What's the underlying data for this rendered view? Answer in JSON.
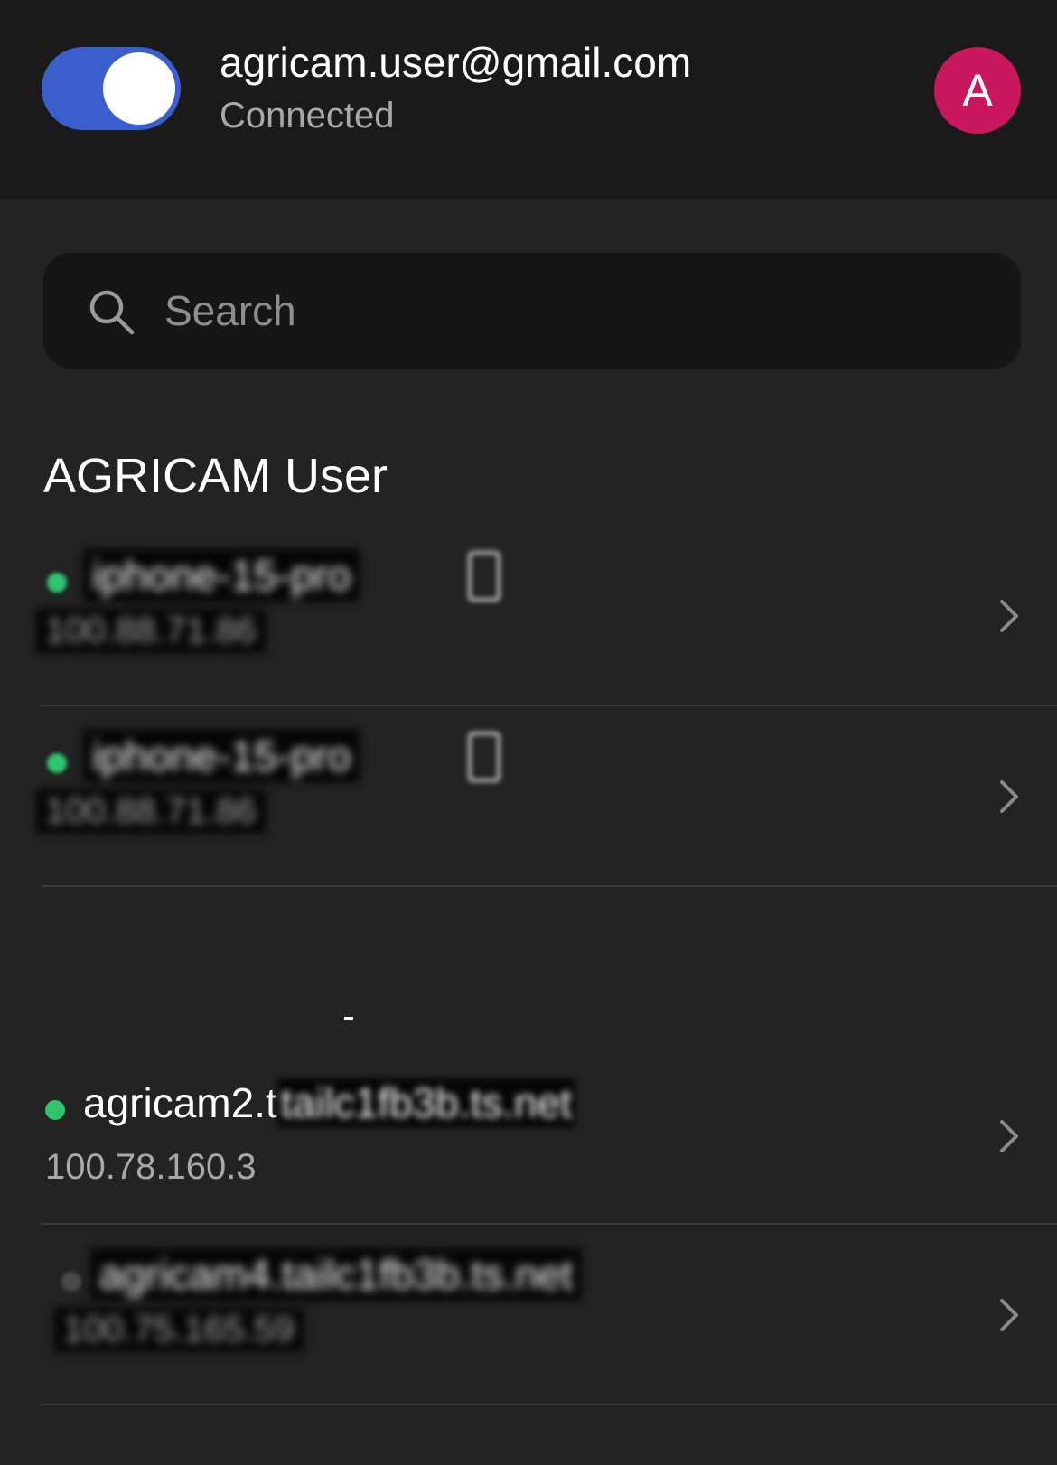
{
  "colors": {
    "background": "#232323",
    "header_background": "#1a1a1a",
    "toggle_on": "#3a5fcd",
    "avatar": "#c8175d",
    "online": "#30c46c",
    "offline": "#4a4a4a"
  },
  "header": {
    "vpn_toggle_on": true,
    "account_email": "agricam.user@gmail.com",
    "status": "Connected",
    "avatar_initial": "A"
  },
  "search": {
    "placeholder": "Search",
    "icon": "search-icon"
  },
  "sections": [
    {
      "title": "AGRICAM User",
      "devices": [
        {
          "name": "iphone-15-pro",
          "ip": "100.88.71.86",
          "online": true,
          "redacted": true,
          "icon": "phone-icon"
        },
        {
          "name": "iphone-15-pro",
          "ip": "100.88.71.86",
          "online": true,
          "redacted": true,
          "icon": "phone-icon"
        }
      ]
    },
    {
      "title": "",
      "devices": [
        {
          "name_visible": "agricam2.t",
          "name_hidden": "tailc1fb3b.ts.net",
          "ip": "100.78.160.3",
          "online": true
        },
        {
          "name": "agricam4.tailc1fb3b.ts.net",
          "ip": "100.75.165.59",
          "online": false,
          "redacted": true
        }
      ]
    }
  ]
}
